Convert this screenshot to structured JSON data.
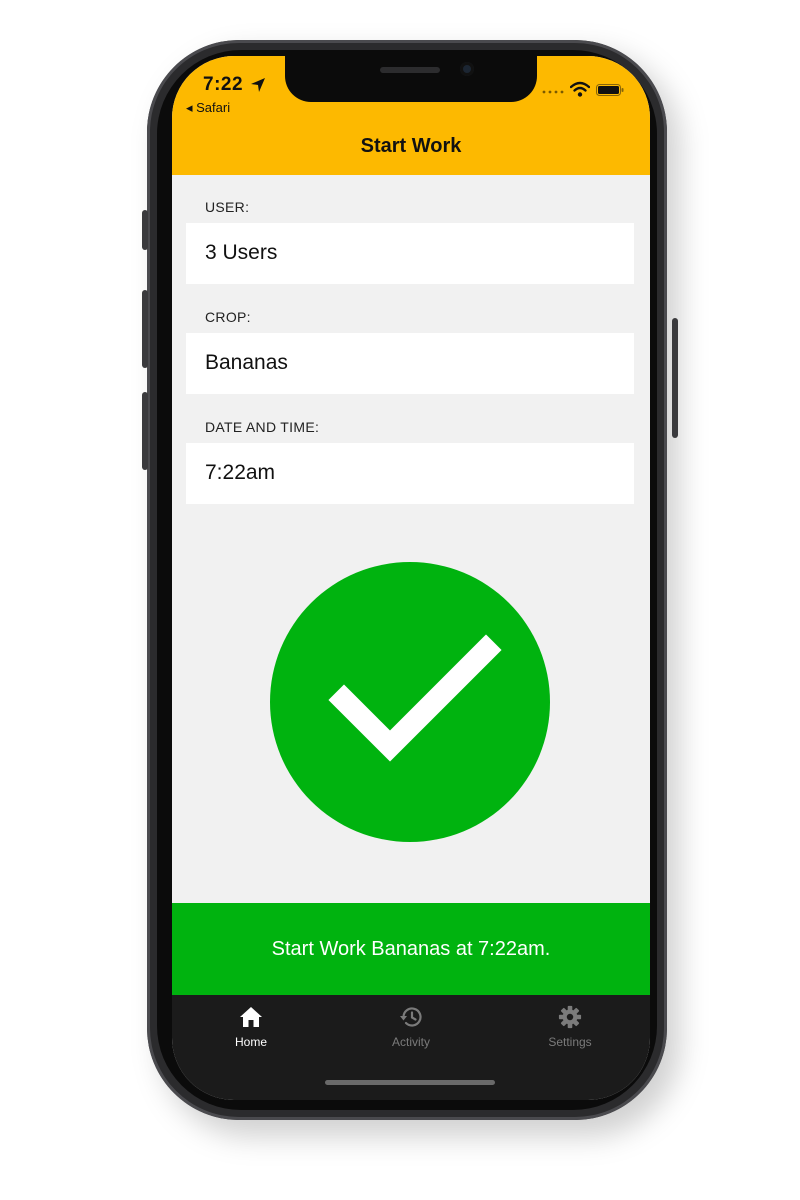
{
  "status_bar": {
    "time": "7:22",
    "back_app": "◂ Safari"
  },
  "header": {
    "title": "Start Work",
    "color": "#fdb900"
  },
  "form": {
    "user": {
      "label": "USER:",
      "value": "3 Users"
    },
    "crop": {
      "label": "CROP:",
      "value": "Bananas"
    },
    "datetime": {
      "label": "DATE AND TIME:",
      "value": "7:22am"
    }
  },
  "confirm": {
    "icon": "checkmark-circle-icon",
    "color": "#00b30f"
  },
  "banner": {
    "text": "Start Work Bananas at 7:22am.",
    "color": "#00b30f"
  },
  "tabs": [
    {
      "label": "Home",
      "icon": "home-icon",
      "active": true
    },
    {
      "label": "Activity",
      "icon": "history-icon",
      "active": false
    },
    {
      "label": "Settings",
      "icon": "gear-icon",
      "active": false
    }
  ]
}
